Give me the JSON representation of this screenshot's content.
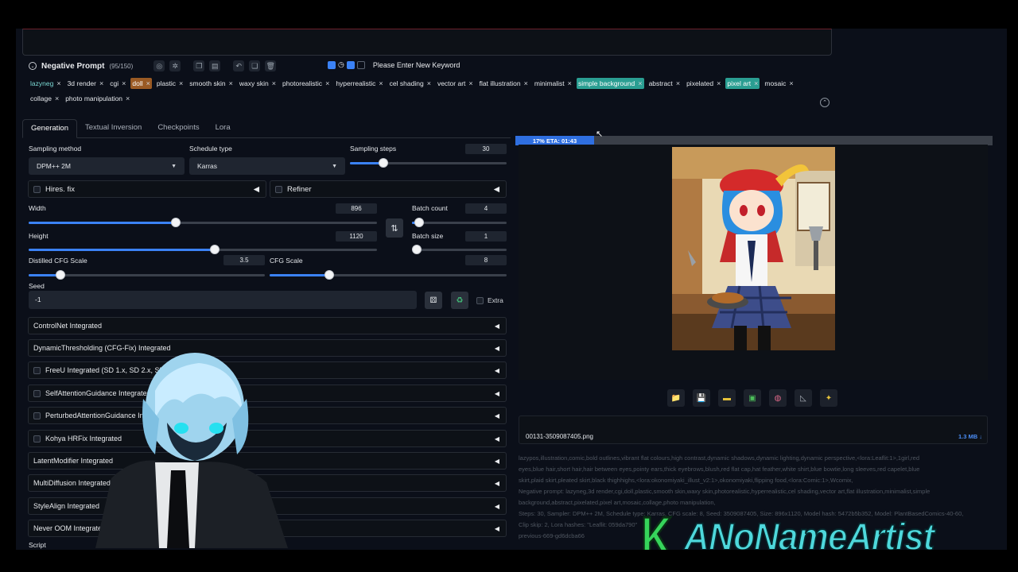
{
  "negative_prompt": {
    "title": "Negative Prompt",
    "count": "(95/150)",
    "keyword_placeholder": "Please Enter New Keyword",
    "tags": [
      {
        "text": "lazyneg",
        "style": "teal"
      },
      {
        "text": "3d render",
        "style": "plain"
      },
      {
        "text": "cgi",
        "style": "plain"
      },
      {
        "text": "doll",
        "style": "orange-bg"
      },
      {
        "text": "plastic",
        "style": "plain"
      },
      {
        "text": "smooth skin",
        "style": "plain"
      },
      {
        "text": "waxy skin",
        "style": "plain"
      },
      {
        "text": "photorealistic",
        "style": "plain"
      },
      {
        "text": "hyperrealistic",
        "style": "plain"
      },
      {
        "text": "cel shading",
        "style": "plain"
      },
      {
        "text": "vector art",
        "style": "plain"
      },
      {
        "text": "flat illustration",
        "style": "plain"
      },
      {
        "text": "minimalist",
        "style": "plain"
      },
      {
        "text": "simple background",
        "style": "teal-bg"
      },
      {
        "text": "abstract",
        "style": "plain"
      },
      {
        "text": "pixelated",
        "style": "plain"
      },
      {
        "text": "pixel art",
        "style": "teal-bg"
      },
      {
        "text": "mosaic",
        "style": "plain"
      },
      {
        "text": "collage",
        "style": "plain"
      },
      {
        "text": "photo manipulation",
        "style": "plain"
      }
    ],
    "tag_close": "×"
  },
  "tabs": [
    "Generation",
    "Textual Inversion",
    "Checkpoints",
    "Lora"
  ],
  "sampling": {
    "method_label": "Sampling method",
    "method_value": "DPM++ 2M",
    "schedule_label": "Schedule type",
    "schedule_value": "Karras",
    "steps_label": "Sampling steps",
    "steps_value": "30"
  },
  "hires_label": "Hires. fix",
  "refiner_label": "Refiner",
  "width": {
    "label": "Width",
    "value": "896"
  },
  "height": {
    "label": "Height",
    "value": "1120"
  },
  "batch_count": {
    "label": "Batch count",
    "value": "4"
  },
  "batch_size": {
    "label": "Batch size",
    "value": "1"
  },
  "distilled_cfg": {
    "label": "Distilled CFG Scale",
    "value": "3.5"
  },
  "cfg": {
    "label": "CFG Scale",
    "value": "8"
  },
  "seed": {
    "label": "Seed",
    "value": "-1",
    "extra_label": "Extra"
  },
  "swap_icon": "⇅",
  "accordions": [
    {
      "label": "ControlNet Integrated",
      "checkbox": false
    },
    {
      "label": "DynamicThresholding (CFG-Fix) Integrated",
      "checkbox": false
    },
    {
      "label": "FreeU Integrated (SD 1.x, SD 2.x, SDXL)",
      "checkbox": true
    },
    {
      "label": "SelfAttentionGuidance Integrated",
      "checkbox": true
    },
    {
      "label": "PerturbedAttentionGuidance Integrated",
      "checkbox": true
    },
    {
      "label": "Kohya HRFix Integrated",
      "checkbox": true
    },
    {
      "label": "LatentModifier Integrated",
      "checkbox": false
    },
    {
      "label": "MultiDiffusion Integrated",
      "checkbox": false
    },
    {
      "label": "StyleAlign Integrated",
      "checkbox": false
    },
    {
      "label": "Never OOM Integrated",
      "checkbox": false
    }
  ],
  "script_label": "Script",
  "progress": {
    "text": "17% ETA: 01:43",
    "fraction": 0.17
  },
  "output": {
    "filename": "00131-3509087405.png",
    "filesize": "1.3 MB ↓",
    "action_icons": [
      "folder-icon",
      "save-icon",
      "zip-icon",
      "image-icon",
      "palette-icon",
      "ruler-icon",
      "sparkle-icon"
    ],
    "infotext_lines": [
      "lazypos,illustration,comic,bold outlines,vibrant flat colours,high contrast,dynamic shadows,dynamic lighting,dynamic perspective,<lora:Leaflit:1>,1girl,red",
      "eyes,blue hair,short hair,hair between eyes,pointy ears,thick eyebrows,blush,red flat cap,hat feather,white shirt,blue bowtie,long sleeves,red capelet,blue",
      "skirt,plaid skirt,pleated skirt,black thighhighs,<lora:okonomiyaki_illust_v2:1>,okonomiyaki,flipping food,<lora:Comic:1>,Wcomix,",
      "Negative prompt: lazyneg,3d render,cgi,doll,plastic,smooth skin,waxy skin,photorealistic,hyperrealistic,cel shading,vector art,flat illustration,minimalist,simple",
      "background,abstract,pixelated,pixel art,mosaic,collage,photo manipulation,",
      "Steps: 30, Sampler: DPM++ 2M, Schedule type: Karras, CFG scale: 8, Seed: 3509087405, Size: 896x1120, Model hash: 5472b5b352, Model: PlantBasedComics-40-60,",
      "Clip skip: 2, Lora hashes: \"Leaflit: 059da790\"",
      "previous-669-gd6dcba66"
    ]
  },
  "watermark": {
    "k": "K",
    "name": "ANoNameArtist"
  },
  "colors": {
    "accent": "#3b82f6",
    "tag_teal": "#2a9e92",
    "tag_orange": "#9a5a24",
    "watermark_green": "#36d45b",
    "watermark_cyan": "#4ed8dc"
  }
}
